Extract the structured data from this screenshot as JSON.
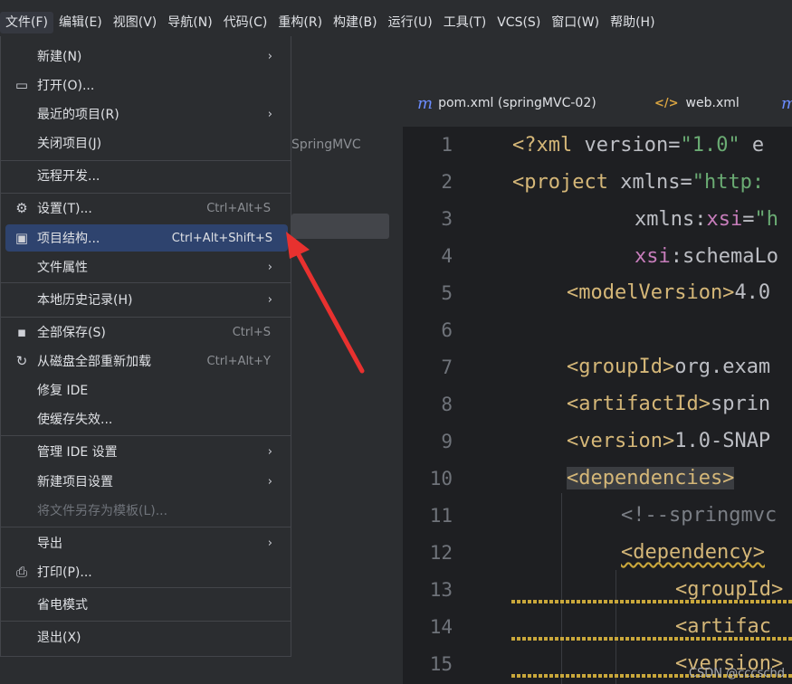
{
  "menubar": {
    "items": [
      "文件(F)",
      "编辑(E)",
      "视图(V)",
      "导航(N)",
      "代码(C)",
      "重构(R)",
      "构建(B)",
      "运行(U)",
      "工具(T)",
      "VCS(S)",
      "窗口(W)",
      "帮助(H)"
    ]
  },
  "project_panel": {
    "partial_text": "SpringMVC"
  },
  "tabs": [
    {
      "icon": "m",
      "label": "pom.xml (springMVC-02)"
    },
    {
      "icon": "</>",
      "label": "web.xml"
    },
    {
      "icon": "m",
      "label": ""
    }
  ],
  "editor": {
    "line_numbers": [
      "1",
      "2",
      "3",
      "4",
      "5",
      "6",
      "7",
      "8",
      "9",
      "10",
      "11",
      "12",
      "13",
      "14",
      "15"
    ]
  },
  "file_menu": {
    "items": [
      {
        "label": "新建(N)",
        "shortcut": "",
        "arrow": "›"
      },
      {
        "label": "打开(O)...",
        "shortcut": "",
        "arrow": ""
      },
      {
        "label": "最近的项目(R)",
        "shortcut": "",
        "arrow": "›"
      },
      {
        "label": "关闭项目(J)",
        "shortcut": "",
        "arrow": ""
      },
      {
        "label": "远程开发...",
        "shortcut": "",
        "arrow": ""
      },
      {
        "label": "设置(T)...",
        "shortcut": "Ctrl+Alt+S",
        "arrow": ""
      },
      {
        "label": "项目结构...",
        "shortcut": "Ctrl+Alt+Shift+S",
        "arrow": ""
      },
      {
        "label": "文件属性",
        "shortcut": "",
        "arrow": "›"
      },
      {
        "label": "本地历史记录(H)",
        "shortcut": "",
        "arrow": "›"
      },
      {
        "label": "全部保存(S)",
        "shortcut": "Ctrl+S",
        "arrow": ""
      },
      {
        "label": "从磁盘全部重新加载",
        "shortcut": "Ctrl+Alt+Y",
        "arrow": ""
      },
      {
        "label": "修复 IDE",
        "shortcut": "",
        "arrow": ""
      },
      {
        "label": "使缓存失效...",
        "shortcut": "",
        "arrow": ""
      },
      {
        "label": "管理 IDE 设置",
        "shortcut": "",
        "arrow": "›"
      },
      {
        "label": "新建项目设置",
        "shortcut": "",
        "arrow": "›"
      },
      {
        "label": "将文件另存为模板(L)...",
        "shortcut": "",
        "arrow": ""
      },
      {
        "label": "导出",
        "shortcut": "",
        "arrow": "›"
      },
      {
        "label": "打印(P)...",
        "shortcut": "",
        "arrow": ""
      },
      {
        "label": "省电模式",
        "shortcut": "",
        "arrow": ""
      },
      {
        "label": "退出(X)",
        "shortcut": "",
        "arrow": ""
      }
    ]
  },
  "code": {
    "l1": {
      "a": "<?xml ",
      "b": "version",
      "c": "=",
      "d": "\"1.0\"",
      "e": " e"
    },
    "l2": {
      "a": "<project ",
      "b": "xmlns",
      "c": "=",
      "d": "\"http:"
    },
    "l3": {
      "a": "xmlns:",
      "b": "xsi",
      "c": "=",
      "d": "\"h"
    },
    "l4": {
      "a": "xsi",
      "b": ":schemaLo"
    },
    "l5": {
      "a": "<modelVersion>",
      "b": "4.0"
    },
    "l7": {
      "a": "<groupId>",
      "b": "org.exam"
    },
    "l8": {
      "a": "<artifactId>",
      "b": "sprin"
    },
    "l9": {
      "a": "<version>",
      "b": "1.0-SNAP"
    },
    "l10": {
      "a": "<dependencies>"
    },
    "l11": {
      "a": "<!--springmvc"
    },
    "l12": {
      "a": "<dependency>"
    },
    "l13": {
      "a": "<groupId>"
    },
    "l14": {
      "a": "<artifac"
    },
    "l15": {
      "a": "<version>"
    }
  },
  "watermark": "CSDN @cccschd",
  "colors": {
    "menu_bg": "#2b2d30",
    "selected": "#2e436e",
    "arrow": "#e8312f",
    "tag": "#d5b778",
    "string": "#6aab73"
  }
}
